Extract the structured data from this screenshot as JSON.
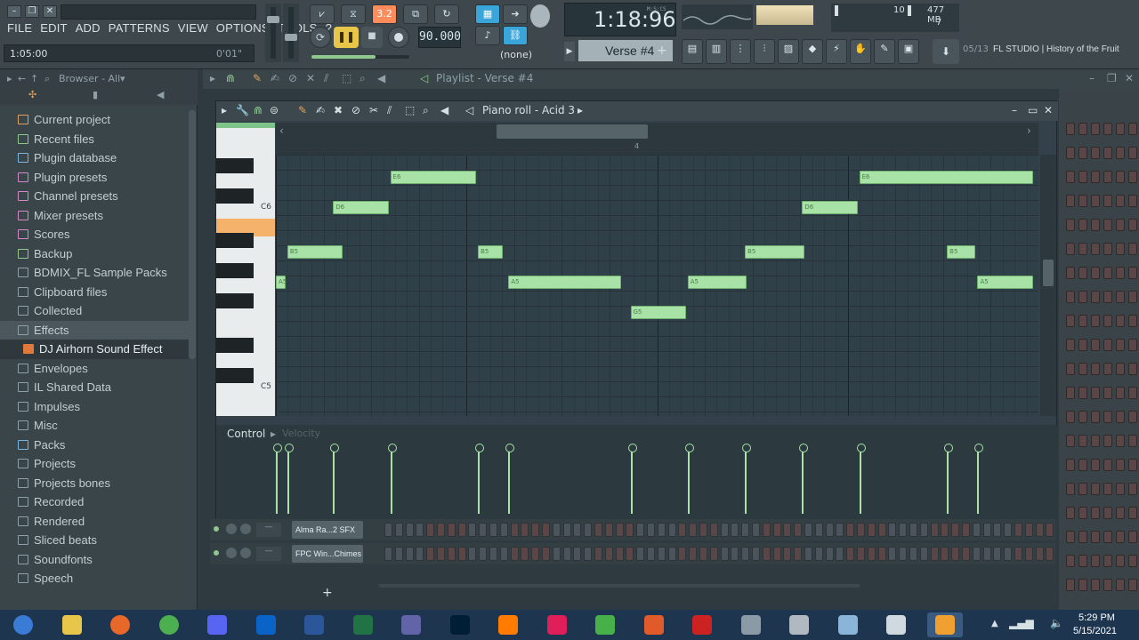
{
  "menu": [
    "FILE",
    "EDIT",
    "ADD",
    "PATTERNS",
    "VIEW",
    "OPTIONS",
    "TOOLS",
    "?"
  ],
  "hint": {
    "time": "1:05:00",
    "right": "0'01\""
  },
  "transport": {
    "pattern_mode": "3.2",
    "tempo": "90.000",
    "song_time": "1:18:96",
    "time_label": "M:S:CS",
    "pattern": "Verse #4",
    "none_label": "(none)"
  },
  "monitor": {
    "cpu": "10",
    "ram": "477 MB",
    "poly": "7"
  },
  "news": {
    "counter": "05/13",
    "text": "FL STUDIO | History of the Fruit"
  },
  "browser": {
    "title": "Browser - All",
    "items": [
      {
        "label": "Current project",
        "icon": "project-icon",
        "color": "#e0a060"
      },
      {
        "label": "Recent files",
        "icon": "folder-icon",
        "color": "#8ec88e"
      },
      {
        "label": "Plugin database",
        "icon": "plugin-icon",
        "color": "#7ab4e0"
      },
      {
        "label": "Plugin presets",
        "icon": "preset-icon",
        "color": "#d08ac8"
      },
      {
        "label": "Channel presets",
        "icon": "preset-icon",
        "color": "#d08ac8"
      },
      {
        "label": "Mixer presets",
        "icon": "preset-icon",
        "color": "#d08ac8"
      },
      {
        "label": "Scores",
        "icon": "note-icon",
        "color": "#d08ac8"
      },
      {
        "label": "Backup",
        "icon": "folder-icon",
        "color": "#8ec88e"
      },
      {
        "label": "BDMIX_FL Sample Packs",
        "icon": "folder-icon",
        "color": "#8fa0a6"
      },
      {
        "label": "Clipboard files",
        "icon": "folder-icon",
        "color": "#8fa0a6"
      },
      {
        "label": "Collected",
        "icon": "folder-icon",
        "color": "#8fa0a6"
      },
      {
        "label": "Effects",
        "icon": "folder-icon",
        "color": "#8fa0a6"
      },
      {
        "label": "DJ Airhorn Sound Effect",
        "icon": "audio-file-icon",
        "color": "#e07a3a"
      },
      {
        "label": "Envelopes",
        "icon": "folder-icon",
        "color": "#8fa0a6"
      },
      {
        "label": "IL Shared Data",
        "icon": "folder-icon",
        "color": "#8fa0a6"
      },
      {
        "label": "Impulses",
        "icon": "folder-icon",
        "color": "#8fa0a6"
      },
      {
        "label": "Misc",
        "icon": "folder-icon",
        "color": "#8fa0a6"
      },
      {
        "label": "Packs",
        "icon": "packs-icon",
        "color": "#7ab4e0"
      },
      {
        "label": "Projects",
        "icon": "folder-icon",
        "color": "#8fa0a6"
      },
      {
        "label": "Projects bones",
        "icon": "folder-icon",
        "color": "#8fa0a6"
      },
      {
        "label": "Recorded",
        "icon": "folder-icon",
        "color": "#8fa0a6"
      },
      {
        "label": "Rendered",
        "icon": "folder-icon",
        "color": "#8fa0a6"
      },
      {
        "label": "Sliced beats",
        "icon": "folder-icon",
        "color": "#8fa0a6"
      },
      {
        "label": "Soundfonts",
        "icon": "folder-icon",
        "color": "#8fa0a6"
      },
      {
        "label": "Speech",
        "icon": "folder-icon",
        "color": "#8fa0a6"
      }
    ]
  },
  "playlist": {
    "title": "Playlist - Verse #4"
  },
  "piano_roll": {
    "title": "Piano roll - Acid 3",
    "bar_marker": "4",
    "key_labels": {
      "c6": "C6",
      "c5": "C5"
    },
    "control_label": "Control",
    "control_param": "Velocity",
    "notes": [
      {
        "label": "A5",
        "start": 0.0,
        "len": 0.3
      },
      {
        "label": "B5",
        "start": 0.3,
        "len": 1.5
      },
      {
        "label": "D6",
        "start": 1.5,
        "len": 1.5
      },
      {
        "label": "E6",
        "start": 3.0,
        "len": 2.3
      },
      {
        "label": "B5",
        "start": 5.3,
        "len": 0.7
      },
      {
        "label": "A5",
        "start": 6.1,
        "len": 3.0
      },
      {
        "label": "G5",
        "start": 9.3,
        "len": 1.5
      },
      {
        "label": "A5",
        "start": 10.8,
        "len": 1.6
      },
      {
        "label": "B5",
        "start": 12.3,
        "len": 1.6
      },
      {
        "label": "D6",
        "start": 13.8,
        "len": 1.5
      },
      {
        "label": "E6",
        "start": 15.3,
        "len": 4.6
      },
      {
        "label": "B5",
        "start": 17.6,
        "len": 0.8
      },
      {
        "label": "A5",
        "start": 18.4,
        "len": 1.5
      }
    ]
  },
  "channels": [
    {
      "name": "Alma Ra...2 SFX"
    },
    {
      "name": "FPC Win...Chimes"
    }
  ],
  "taskbar": {
    "time": "5:29 PM",
    "date": "5/15/2021",
    "apps": [
      "start-icon",
      "explorer-icon",
      "firefox-icon",
      "chrome-icon",
      "discord-icon",
      "outlook-icon",
      "word-icon",
      "excel-icon",
      "teams-icon",
      "photoshop-icon",
      "illustrator-icon",
      "slack-icon",
      "camtasia-icon",
      "camtasia-recorder-icon",
      "7zip-icon",
      "network-icon",
      "calculator-icon",
      "notepad-icon",
      "sublime-icon",
      "fl-studio-icon"
    ]
  }
}
